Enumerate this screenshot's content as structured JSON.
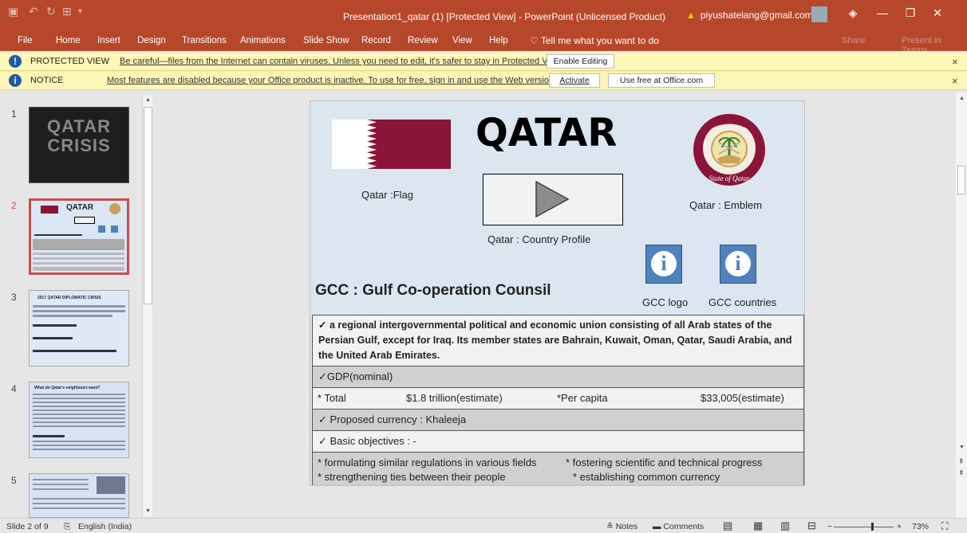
{
  "window": {
    "title": "Presentation1_qatar (1) [Protected View]  -  PowerPoint (Unlicensed Product)",
    "account": "piyushatelang@gmail.com",
    "min": "—",
    "restore": "❐",
    "close": "✕"
  },
  "menu": {
    "items": [
      "File",
      "Home",
      "Insert",
      "Design",
      "Transitions",
      "Animations",
      "Slide Show",
      "Record",
      "Review",
      "View",
      "Help"
    ],
    "tell_me": "Tell me what you want to do",
    "share": "Share",
    "present": "Present in Teams"
  },
  "protected": {
    "title": "PROTECTED VIEW",
    "text": "Be careful—files from the Internet can contain viruses. Unless you need to edit, it's safer to stay in Protected View.",
    "button": "Enable Editing"
  },
  "notice": {
    "title": "NOTICE",
    "text": "Most features are disabled because your Office product is inactive. To use for free, sign in and use the Web version.",
    "activate": "Activate",
    "use_free": "Use free at Office.com"
  },
  "thumbnails": {
    "numbers": [
      "1",
      "2",
      "3",
      "4",
      "5"
    ],
    "t1_text": "QATAR CRISIS",
    "t2_title": "QATAR",
    "t3_title": "2017 QATAR DIPLOMATIC CRISIS",
    "t4_title": "What do Qatar's neighbours want?"
  },
  "slide": {
    "title": "QATAR",
    "flag_label": "Qatar :Flag",
    "country_profile_label": "Qatar : Country Profile",
    "emblem_label": "Qatar : Emblem",
    "gcc_title": "GCC  :  Gulf Co-operation Counsil",
    "gcc_logo_label": "GCC  logo",
    "gcc_countries_label": "GCC countries",
    "info_icon": "i",
    "row1": "✓ a regional intergovernmental political and economic union consisting of all Arab states of the Persian Gulf, except for Iraq. Its member states are Bahrain, Kuwait, Oman, Qatar, Saudi Arabia, and the United Arab Emirates.",
    "row2": "✓GDP(nominal)",
    "row3_total_label": "* Total",
    "row3_total_value": "$1.8 trillion(estimate)",
    "row3_percap_label": "*Per capita",
    "row3_percap_value": "$33,005(estimate)",
    "row4": "✓  Proposed currency : Khaleeja",
    "row5": "✓ Basic objectives : -",
    "row6_a": "* formulating similar regulations in various fields",
    "row6_b": "* fostering scientific and technical progress",
    "row6_c": "* strengthening ties between their people",
    "row6_d": "* establishing common currency"
  },
  "status": {
    "slide": "Slide 2 of 9",
    "language": "English (India)",
    "notes": "Notes",
    "comments": "Comments",
    "zoom": "73%"
  },
  "colors": {
    "accent": "#b7472a",
    "flag_maroon": "#8a1538",
    "notice_bg": "#fcf7b6",
    "info_blue": "#4f81bd"
  }
}
